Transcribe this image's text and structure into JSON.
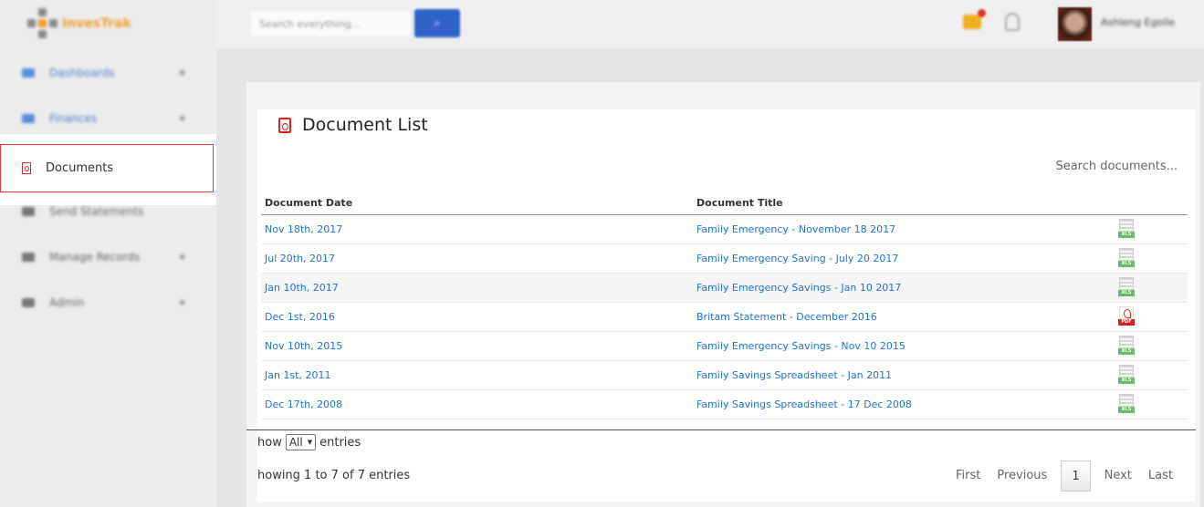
{
  "brand": {
    "name": "InvesTrak"
  },
  "topbar": {
    "search_placeholder": "Search everything...",
    "search_button_icon": "search-icon",
    "username": "Ashleng Egolle"
  },
  "sidebar": {
    "items": [
      {
        "label": "Dashboards",
        "icon": "cloud-icon"
      },
      {
        "label": "Finances",
        "icon": "grid-icon"
      },
      {
        "label": "Documents",
        "icon": "pdf-icon"
      },
      {
        "label": "Send Statements",
        "icon": "list-icon"
      },
      {
        "label": "Manage Records",
        "icon": "printer-icon"
      },
      {
        "label": "Admin",
        "icon": "card-icon"
      }
    ]
  },
  "main": {
    "title": "Document List",
    "search_placeholder": "Search documents...",
    "columns": {
      "date": "Document Date",
      "title": "Document Title"
    },
    "rows": [
      {
        "date": "Nov 18th, 2017",
        "title": "Family Emergency - November 18 2017",
        "type": "XLS"
      },
      {
        "date": "Jul 20th, 2017",
        "title": "Family Emergency Saving - July 20 2017",
        "type": "XLS"
      },
      {
        "date": "Jan 10th, 2017",
        "title": "Family Emergency Savings - Jan 10 2017",
        "type": "XLS"
      },
      {
        "date": "Dec 1st, 2016",
        "title": "Britam Statement - December 2016",
        "type": "PDF"
      },
      {
        "date": "Nov 10th, 2015",
        "title": "Family Emergency Savings - Nov 10 2015",
        "type": "XLS"
      },
      {
        "date": "Jan 1st, 2011",
        "title": "Family Savings Spreadsheet - Jan 2011",
        "type": "XLS"
      },
      {
        "date": "Dec 17th, 2008",
        "title": "Family Savings Spreadsheet - 17 Dec 2008",
        "type": "XLS"
      }
    ],
    "length": {
      "prefix": "how",
      "value": "All",
      "suffix": "entries"
    },
    "info": "howing 1 to 7 of 7 entries",
    "pager": {
      "first": "First",
      "previous": "Previous",
      "current": "1",
      "next": "Next",
      "last": "Last"
    }
  },
  "colors": {
    "accent": "#2f62c9",
    "link": "#1b74d8",
    "pdf": "#e02424",
    "xls": "#6cb86c"
  }
}
